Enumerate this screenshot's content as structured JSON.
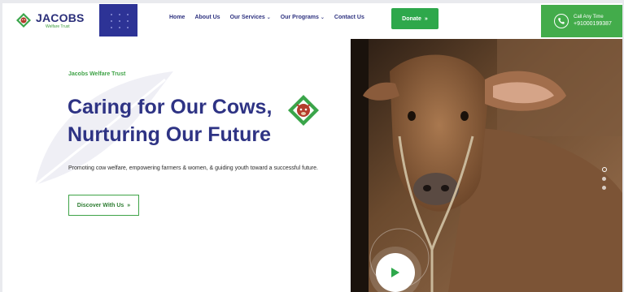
{
  "brand": {
    "name": "JACOBS",
    "tagline": "Welfare Trust"
  },
  "nav": {
    "items": [
      {
        "label": "Home"
      },
      {
        "label": "About Us"
      },
      {
        "label": "Our Services",
        "has_caret": true
      },
      {
        "label": "Our Programs",
        "has_caret": true
      },
      {
        "label": "Contact Us"
      }
    ]
  },
  "donate": {
    "label": "Donate",
    "icon": "double-chevron-right-icon"
  },
  "call": {
    "label": "Call Any Time",
    "number": "+91000199387",
    "icon": "phone-icon"
  },
  "hero": {
    "eyebrow": "Jacobs Welfare Trust",
    "headline_line1": "Caring for Our Cows,",
    "headline_line2": "Nurturing Our Future",
    "description": "Promoting cow welfare, empowering farmers & women, & guiding youth toward a successful future.",
    "cta_label": "Discover With Us",
    "cta_icon": "double-chevron-right-icon"
  },
  "slider": {
    "dots": 3,
    "active_index": 0
  },
  "colors": {
    "navy": "#2e3384",
    "green": "#2ea84b",
    "call_green": "#43ac4b"
  }
}
